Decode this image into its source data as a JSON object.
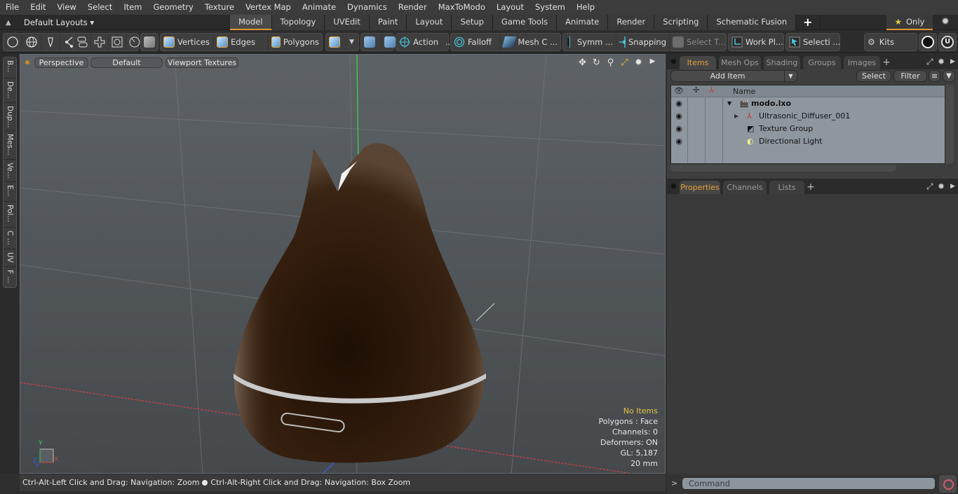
{
  "menubar": {
    "items": [
      "File",
      "Edit",
      "View",
      "Select",
      "Item",
      "Geometry",
      "Texture",
      "Vertex Map",
      "Animate",
      "Dynamics",
      "Render",
      "MaxToModo",
      "Layout",
      "System",
      "Help"
    ]
  },
  "layouts": {
    "label": "Default Layouts ▾",
    "tabs": [
      "Model",
      "Topology",
      "UVEdit",
      "Paint",
      "Layout",
      "Setup",
      "Game Tools",
      "Animate",
      "Render",
      "Scripting",
      "Schematic Fusion"
    ],
    "active_tab": "Model",
    "add_tab": "+",
    "only_label": "Only",
    "only_icon": "star-icon",
    "settings_icon": "gear-icon"
  },
  "toolbar": {
    "select_mode_icons": [
      "circle-select-icon",
      "globe-select-icon",
      "lasso-pen-icon",
      "connect-select-icon"
    ],
    "layout_icons": [
      "stack-icon",
      "cross-icon",
      "frame-icon",
      "clock-icon"
    ],
    "vertices": "Vertices",
    "edges": "Edges",
    "polygons": "Polygons",
    "action": "Action",
    "action_more": "...",
    "falloff": "Falloff",
    "mesh_c": "Mesh C ...",
    "symm": "Symm ...",
    "snapping": "Snapping",
    "select_t": "Select T...",
    "work_pl": "Work Pl...",
    "selecti": "Selecti ...",
    "kits": "Kits"
  },
  "sidebar": {
    "tabs": [
      "B...",
      "De...",
      "Dup...",
      "Mes...",
      "Ve...",
      "E...",
      "Pol...",
      "C ...",
      "UV",
      "F ..."
    ]
  },
  "viewport": {
    "view_mode": "Perspective",
    "shading": "Default",
    "textures": "Viewport Textures",
    "nav_icons": [
      "move-icon",
      "rotate-icon",
      "zoom-icon",
      "fit-icon",
      "settings-icon",
      "more-icon"
    ],
    "info": {
      "selection": "No Items",
      "polygons": "Polygons : Face",
      "channels": "Channels: 0",
      "deformers": "Deformers: ON",
      "gl": "GL: 5,187",
      "scale": "20 mm"
    },
    "axis_labels": {
      "y": "Y",
      "x": "X",
      "z": "Z"
    }
  },
  "statusbar": {
    "hint1": "Ctrl-Alt-Left Click and Drag: Navigation: Zoom",
    "hint2": "Ctrl-Alt-Right Click and Drag: Navigation: Box Zoom"
  },
  "items_panel": {
    "tabs": [
      "Items",
      "Mesh Ops",
      "Shading",
      "Groups",
      "Images"
    ],
    "active_tab": "Items",
    "add_item": "Add Item",
    "select": "Select",
    "filter": "Filter",
    "column_name": "Name",
    "rows": [
      {
        "name": "modo.lxo",
        "icon": "scene-clapper-icon",
        "expander": "▼",
        "bold": true
      },
      {
        "name": "Ultrasonic_Diffuser_001",
        "icon": "mesh-locator-icon",
        "expander": "▶",
        "bold": false
      },
      {
        "name": "Texture Group",
        "icon": "texture-group-icon",
        "expander": "",
        "bold": false
      },
      {
        "name": "Directional Light",
        "icon": "light-icon",
        "expander": "",
        "bold": false
      }
    ]
  },
  "properties_panel": {
    "tabs": [
      "Properties",
      "Channels",
      "Lists"
    ],
    "active_tab": "Properties"
  },
  "command": {
    "prompt": ">",
    "placeholder": "Command"
  },
  "colors": {
    "accent": "#e0962e",
    "info_highlight": "#e8c048",
    "object_wood": "#2a170c"
  }
}
